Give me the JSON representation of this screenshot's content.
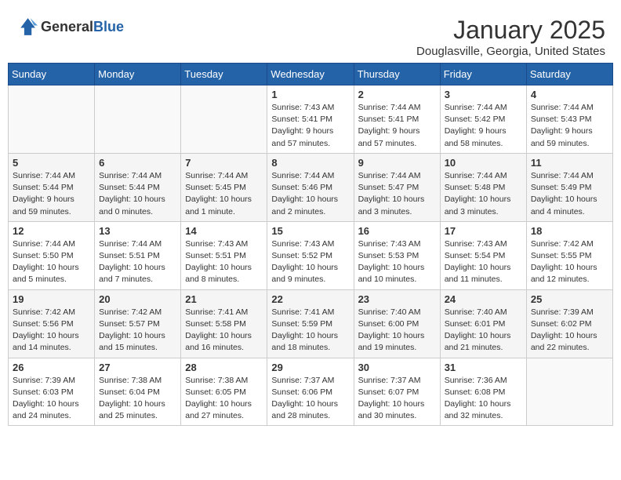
{
  "header": {
    "logo_general": "General",
    "logo_blue": "Blue",
    "month": "January 2025",
    "location": "Douglasville, Georgia, United States"
  },
  "days_of_week": [
    "Sunday",
    "Monday",
    "Tuesday",
    "Wednesday",
    "Thursday",
    "Friday",
    "Saturday"
  ],
  "weeks": [
    [
      {
        "day": "",
        "info": ""
      },
      {
        "day": "",
        "info": ""
      },
      {
        "day": "",
        "info": ""
      },
      {
        "day": "1",
        "info": "Sunrise: 7:43 AM\nSunset: 5:41 PM\nDaylight: 9 hours\nand 57 minutes."
      },
      {
        "day": "2",
        "info": "Sunrise: 7:44 AM\nSunset: 5:41 PM\nDaylight: 9 hours\nand 57 minutes."
      },
      {
        "day": "3",
        "info": "Sunrise: 7:44 AM\nSunset: 5:42 PM\nDaylight: 9 hours\nand 58 minutes."
      },
      {
        "day": "4",
        "info": "Sunrise: 7:44 AM\nSunset: 5:43 PM\nDaylight: 9 hours\nand 59 minutes."
      }
    ],
    [
      {
        "day": "5",
        "info": "Sunrise: 7:44 AM\nSunset: 5:44 PM\nDaylight: 9 hours\nand 59 minutes."
      },
      {
        "day": "6",
        "info": "Sunrise: 7:44 AM\nSunset: 5:44 PM\nDaylight: 10 hours\nand 0 minutes."
      },
      {
        "day": "7",
        "info": "Sunrise: 7:44 AM\nSunset: 5:45 PM\nDaylight: 10 hours\nand 1 minute."
      },
      {
        "day": "8",
        "info": "Sunrise: 7:44 AM\nSunset: 5:46 PM\nDaylight: 10 hours\nand 2 minutes."
      },
      {
        "day": "9",
        "info": "Sunrise: 7:44 AM\nSunset: 5:47 PM\nDaylight: 10 hours\nand 3 minutes."
      },
      {
        "day": "10",
        "info": "Sunrise: 7:44 AM\nSunset: 5:48 PM\nDaylight: 10 hours\nand 3 minutes."
      },
      {
        "day": "11",
        "info": "Sunrise: 7:44 AM\nSunset: 5:49 PM\nDaylight: 10 hours\nand 4 minutes."
      }
    ],
    [
      {
        "day": "12",
        "info": "Sunrise: 7:44 AM\nSunset: 5:50 PM\nDaylight: 10 hours\nand 5 minutes."
      },
      {
        "day": "13",
        "info": "Sunrise: 7:44 AM\nSunset: 5:51 PM\nDaylight: 10 hours\nand 7 minutes."
      },
      {
        "day": "14",
        "info": "Sunrise: 7:43 AM\nSunset: 5:51 PM\nDaylight: 10 hours\nand 8 minutes."
      },
      {
        "day": "15",
        "info": "Sunrise: 7:43 AM\nSunset: 5:52 PM\nDaylight: 10 hours\nand 9 minutes."
      },
      {
        "day": "16",
        "info": "Sunrise: 7:43 AM\nSunset: 5:53 PM\nDaylight: 10 hours\nand 10 minutes."
      },
      {
        "day": "17",
        "info": "Sunrise: 7:43 AM\nSunset: 5:54 PM\nDaylight: 10 hours\nand 11 minutes."
      },
      {
        "day": "18",
        "info": "Sunrise: 7:42 AM\nSunset: 5:55 PM\nDaylight: 10 hours\nand 12 minutes."
      }
    ],
    [
      {
        "day": "19",
        "info": "Sunrise: 7:42 AM\nSunset: 5:56 PM\nDaylight: 10 hours\nand 14 minutes."
      },
      {
        "day": "20",
        "info": "Sunrise: 7:42 AM\nSunset: 5:57 PM\nDaylight: 10 hours\nand 15 minutes."
      },
      {
        "day": "21",
        "info": "Sunrise: 7:41 AM\nSunset: 5:58 PM\nDaylight: 10 hours\nand 16 minutes."
      },
      {
        "day": "22",
        "info": "Sunrise: 7:41 AM\nSunset: 5:59 PM\nDaylight: 10 hours\nand 18 minutes."
      },
      {
        "day": "23",
        "info": "Sunrise: 7:40 AM\nSunset: 6:00 PM\nDaylight: 10 hours\nand 19 minutes."
      },
      {
        "day": "24",
        "info": "Sunrise: 7:40 AM\nSunset: 6:01 PM\nDaylight: 10 hours\nand 21 minutes."
      },
      {
        "day": "25",
        "info": "Sunrise: 7:39 AM\nSunset: 6:02 PM\nDaylight: 10 hours\nand 22 minutes."
      }
    ],
    [
      {
        "day": "26",
        "info": "Sunrise: 7:39 AM\nSunset: 6:03 PM\nDaylight: 10 hours\nand 24 minutes."
      },
      {
        "day": "27",
        "info": "Sunrise: 7:38 AM\nSunset: 6:04 PM\nDaylight: 10 hours\nand 25 minutes."
      },
      {
        "day": "28",
        "info": "Sunrise: 7:38 AM\nSunset: 6:05 PM\nDaylight: 10 hours\nand 27 minutes."
      },
      {
        "day": "29",
        "info": "Sunrise: 7:37 AM\nSunset: 6:06 PM\nDaylight: 10 hours\nand 28 minutes."
      },
      {
        "day": "30",
        "info": "Sunrise: 7:37 AM\nSunset: 6:07 PM\nDaylight: 10 hours\nand 30 minutes."
      },
      {
        "day": "31",
        "info": "Sunrise: 7:36 AM\nSunset: 6:08 PM\nDaylight: 10 hours\nand 32 minutes."
      },
      {
        "day": "",
        "info": ""
      }
    ]
  ]
}
